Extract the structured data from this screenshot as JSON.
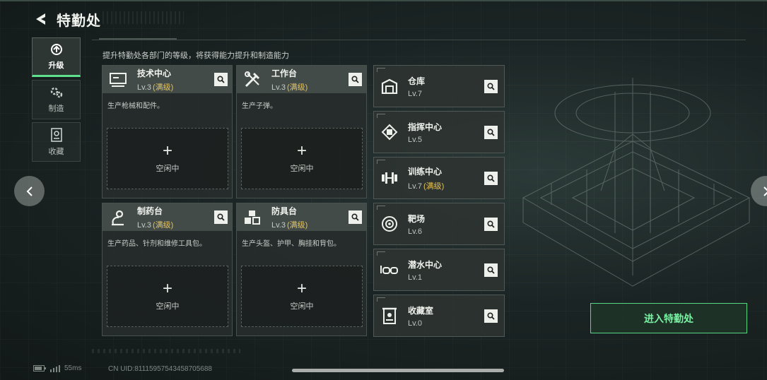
{
  "header": {
    "title": "特勤处",
    "back_icon": "back-arrow-icon"
  },
  "sidenav": {
    "items": [
      {
        "label": "升级",
        "icon": "upgrade-icon",
        "active": true
      },
      {
        "label": "制造",
        "icon": "gears-icon",
        "active": false
      },
      {
        "label": "收藏",
        "icon": "collection-icon",
        "active": false
      }
    ]
  },
  "description": "提升特勤处各部门的等级，将获得能力提升和制造能力",
  "cards": [
    {
      "name": "技术中心",
      "level": "Lv.3",
      "status": "(满级)",
      "desc": "生产枪械和配件。",
      "slot_label": "空闲中",
      "icon": "computer-icon"
    },
    {
      "name": "工作台",
      "level": "Lv.3",
      "status": "(满级)",
      "desc": "生产子弹。",
      "slot_label": "空闲中",
      "icon": "tools-icon"
    },
    {
      "name": "制药台",
      "level": "Lv.3",
      "status": "(满级)",
      "desc": "生产药品、针剂和维修工具包。",
      "slot_label": "空闲中",
      "icon": "microscope-icon"
    },
    {
      "name": "防具台",
      "level": "Lv.3",
      "status": "(满级)",
      "desc": "生产头盔、护甲、胸挂和背包。",
      "slot_label": "空闲中",
      "icon": "armor-icon"
    }
  ],
  "facilities": [
    {
      "name": "仓库",
      "level": "Lv.7",
      "status": "",
      "icon": "warehouse-icon"
    },
    {
      "name": "指挥中心",
      "level": "Lv.5",
      "status": "",
      "icon": "command-chip-icon"
    },
    {
      "name": "训练中心",
      "level": "Lv.7",
      "status": "(满级)",
      "icon": "dumbbell-icon"
    },
    {
      "name": "靶场",
      "level": "Lv.6",
      "status": "",
      "icon": "target-icon"
    },
    {
      "name": "潜水中心",
      "level": "Lv.1",
      "status": "",
      "icon": "goggles-icon"
    },
    {
      "name": "收藏室",
      "level": "Lv.0",
      "status": "",
      "icon": "vault-icon"
    }
  ],
  "enter_button": "进入特勤处",
  "status": {
    "ping": "55ms",
    "uid": "CN UID:81115957543458705688"
  },
  "colors": {
    "accent_green": "#5ee08e",
    "maxed_yellow": "#e5c35a"
  }
}
